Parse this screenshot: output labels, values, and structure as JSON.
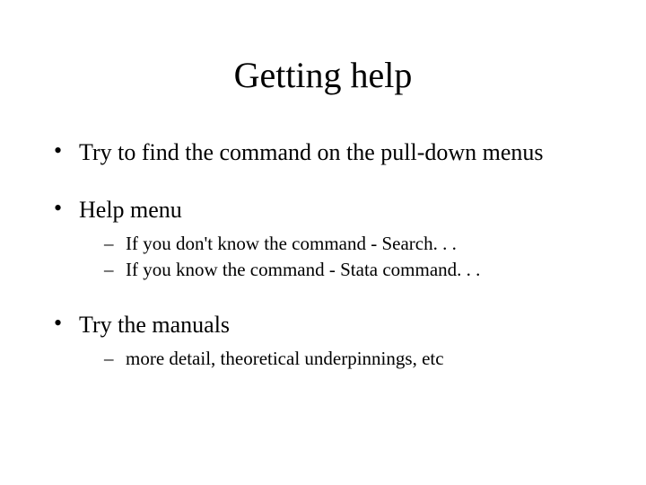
{
  "title": "Getting help",
  "bullets": [
    {
      "text": "Try to find the command on the pull-down menus",
      "children": []
    },
    {
      "text": "Help menu",
      "children": [
        "If you don't know the command - Search. . .",
        "If you know the command - Stata command. . ."
      ]
    },
    {
      "text": "Try the manuals",
      "children": [
        "more detail, theoretical underpinnings, etc"
      ]
    }
  ]
}
